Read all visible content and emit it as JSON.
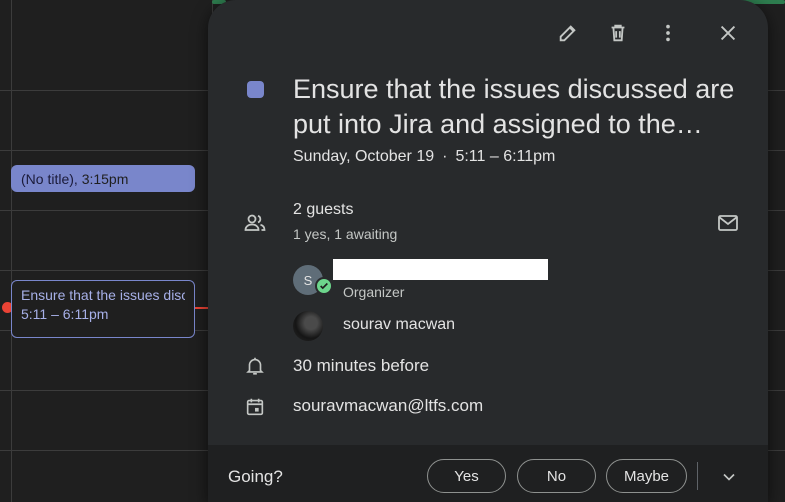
{
  "calendar": {
    "event_no_title": {
      "title": "(No title),",
      "time": "3:15pm"
    },
    "event_selected": {
      "title": "Ensure that the issues discussed are put into Jira and assigned to the",
      "time": "5:11 – 6:11pm"
    }
  },
  "popup": {
    "toolbar": {
      "edit_icon": "pencil-icon",
      "delete_icon": "trash-icon",
      "more_icon": "more-vert-icon",
      "close_icon": "close-icon"
    },
    "event_color": "#7986cb",
    "title": "Ensure that the issues discussed are put into Jira and assigned to the…",
    "date": "Sunday, October 19",
    "separator": "·",
    "time": "5:11 – 6:11pm",
    "guests": {
      "count_label": "2 guests",
      "summary": "1 yes, 1 awaiting",
      "list": [
        {
          "avatar_letter": "S",
          "role": "Organizer",
          "status": "yes"
        },
        {
          "name": "sourav macwan"
        }
      ]
    },
    "reminder": "30 minutes before",
    "calendar_owner": "souravmacwan@ltfs.com",
    "footer": {
      "going_label": "Going?",
      "yes": "Yes",
      "no": "No",
      "maybe": "Maybe"
    }
  }
}
